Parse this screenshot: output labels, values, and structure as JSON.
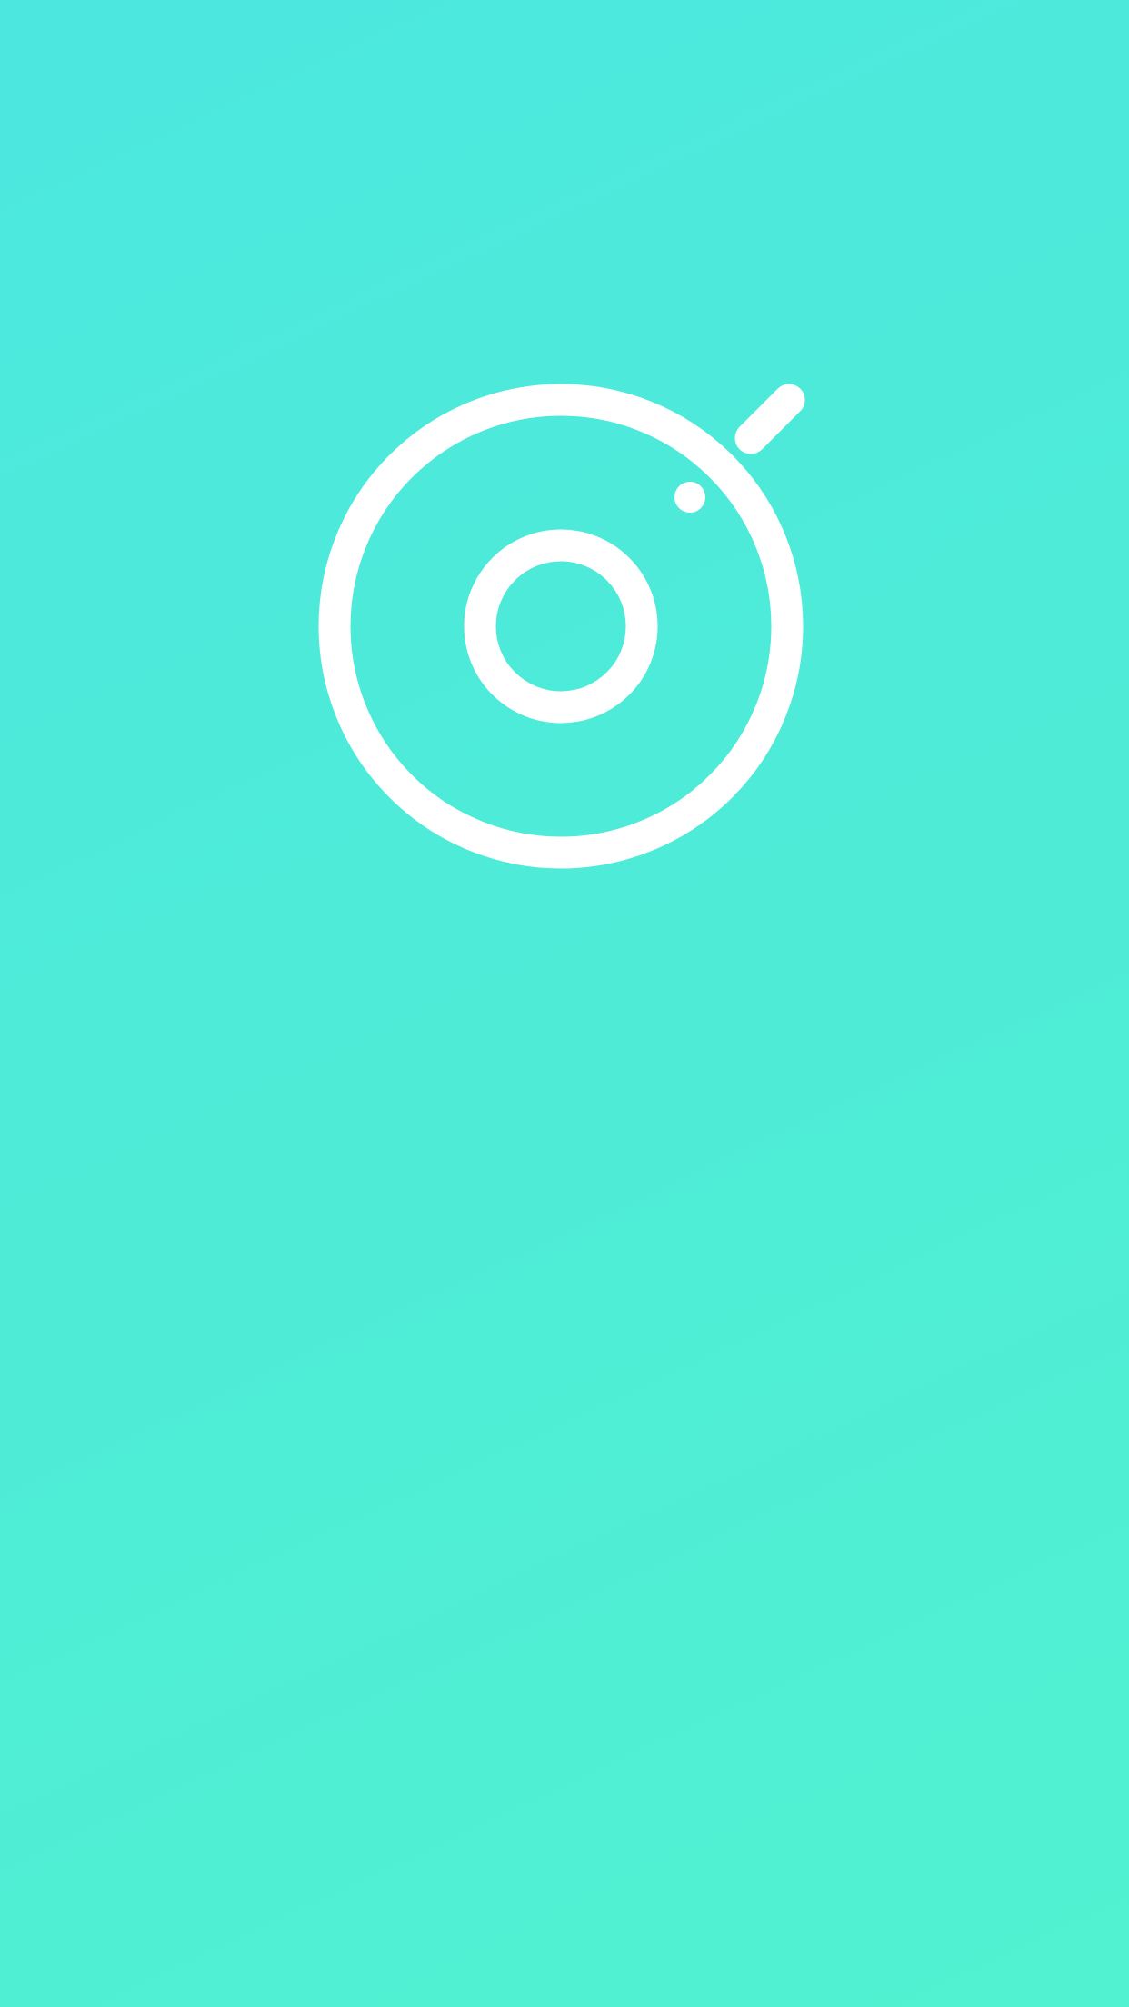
{
  "screen": {
    "type": "splash",
    "background_gradient": [
      "#4ce8e0",
      "#4eecd6",
      "#50f2d2"
    ]
  },
  "logo": {
    "icon": "camera-lens-icon",
    "color": "#ffffff"
  }
}
